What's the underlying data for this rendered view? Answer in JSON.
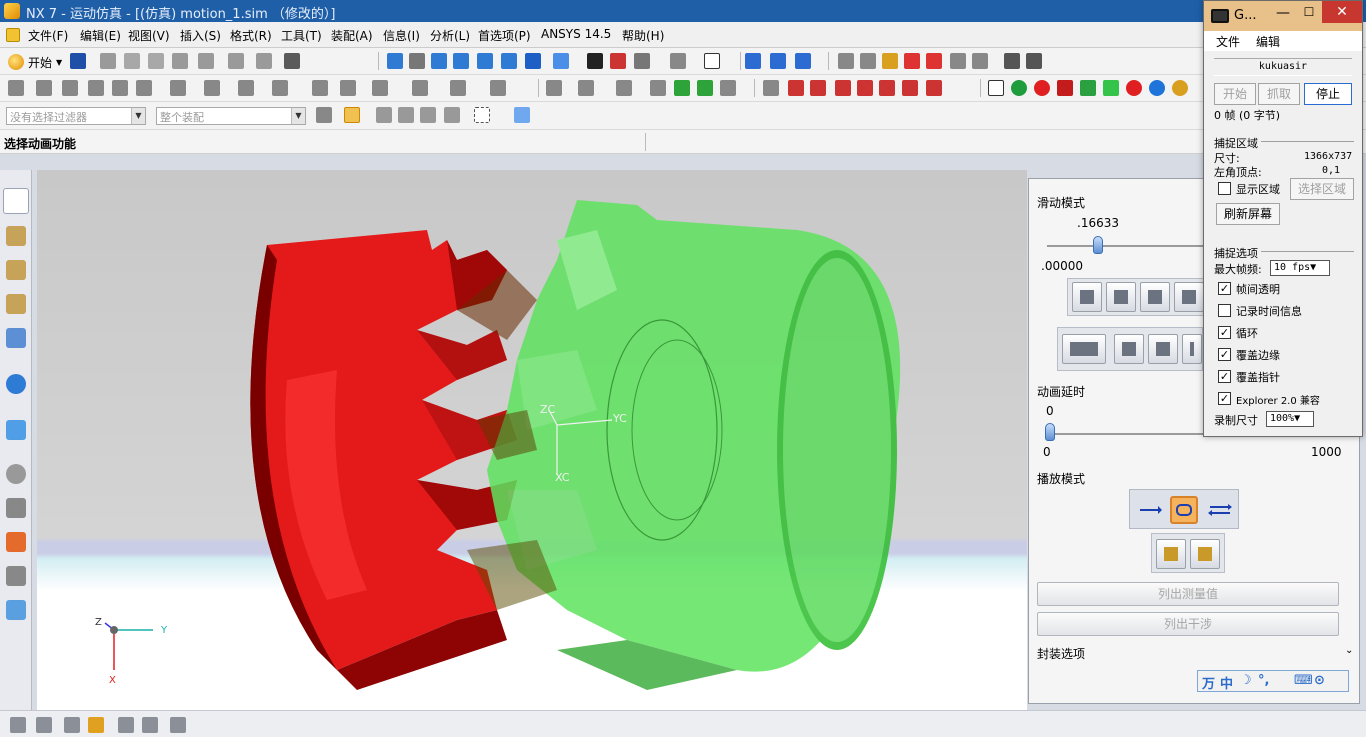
{
  "window": {
    "title": "NX 7 - 运动仿真 - [(仿真) motion_1.sim （修改的）]"
  },
  "menu": {
    "items": [
      "文件(F)",
      "编辑(E)",
      "视图(V)",
      "插入(S)",
      "格式(R)",
      "工具(T)",
      "装配(A)",
      "信息(I)",
      "分析(L)",
      "首选项(P)",
      "ANSYS 14.5",
      "帮助(H)"
    ]
  },
  "toolbar": {
    "start_label": "开始",
    "selection_filter": "没有选择过滤器",
    "assembly_scope": "整个装配"
  },
  "status": {
    "prompt": "选择动画功能"
  },
  "graphics": {
    "wcs_labels": {
      "zc": "ZC",
      "yc": "YC",
      "xc": "XC"
    },
    "triad_labels": {
      "z": "Z",
      "y": "Y",
      "x": "X"
    },
    "colors": {
      "red_gear": "#e00000",
      "green_gear": "#4fdc4f",
      "background": "#d4d4d4"
    }
  },
  "animation_dialog": {
    "slide_mode_label": "滑动模式",
    "slide_value": ".16633",
    "slide_min": ".00000",
    "slide_fraction": 0.17,
    "delay_label": "动画延时",
    "delay_value": "0",
    "delay_min": "0",
    "delay_max": "1000",
    "play_mode_label": "播放模式",
    "list_measures_button": "列出测量值",
    "list_interference_button": "列出干涉",
    "package_options_label": "封装选项"
  },
  "ime": {
    "chars": [
      "万",
      "中",
      "☽",
      "°,",
      "⌨",
      "⊙"
    ]
  },
  "capture_window": {
    "title": "G...",
    "min_icon": "minimize-icon",
    "max_icon": "maximize-icon",
    "close_icon": "close-icon",
    "menu": {
      "file": "文件",
      "edit": "编辑"
    },
    "name": "kukuasir",
    "buttons": {
      "start": "开始",
      "grab": "抓取",
      "stop": "停止"
    },
    "frame_info": "0 帧 (0 字节)",
    "capture_area": {
      "section": "捕捉区域",
      "size_label": "尺寸:",
      "size_value": "1366x737",
      "corner_label": "左角顶点:",
      "corner_value": "0,1",
      "show_area": "显示区域",
      "select_area": "选择区域",
      "refresh": "刷新屏幕"
    },
    "capture_options": {
      "section": "捕捉选项",
      "max_fps_label": "最大帧频:",
      "max_fps_value": "10 fps▼",
      "frame_transparent": "帧间透明",
      "record_time": "记录时间信息",
      "loop": "循环",
      "cover_border": "覆盖边缘",
      "cover_pointer": "覆盖指针",
      "explorer": "Explorer 2.0 兼容",
      "record_size_label": "录制尺寸",
      "record_size_value": "100%▼"
    },
    "checks": {
      "show_area": false,
      "frame_transparent": true,
      "record_time": false,
      "loop": true,
      "cover_border": true,
      "cover_pointer": true,
      "explorer": true
    }
  }
}
